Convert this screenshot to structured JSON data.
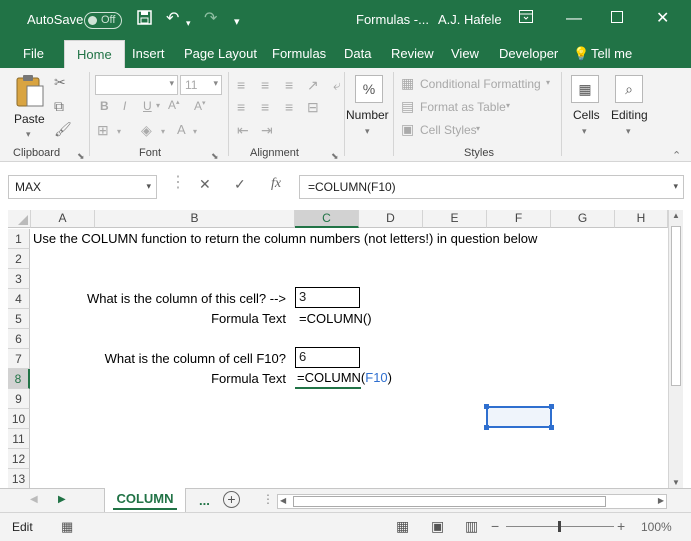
{
  "titlebar": {
    "autosave_label": "AutoSave",
    "autosave_state": "Off",
    "file_title": "Formulas -...",
    "user_name": "A.J. Hafele",
    "save_icon": "save-icon",
    "undo_icon": "undo-icon",
    "redo_icon": "redo-icon"
  },
  "tabs": [
    "File",
    "Home",
    "Insert",
    "Page Layout",
    "Formulas",
    "Data",
    "Review",
    "View",
    "Developer"
  ],
  "tell_me": "Tell me",
  "ribbon": {
    "paste": "Paste",
    "clipboard": "Clipboard",
    "font_group": "Font",
    "font_size": "11",
    "bold": "B",
    "italic": "I",
    "underline": "U",
    "alignment": "Alignment",
    "number": "Number",
    "number_symbol": "%",
    "conditional_formatting": "Conditional Formatting",
    "format_as_table": "Format as Table",
    "cell_styles": "Cell Styles",
    "styles": "Styles",
    "cells": "Cells",
    "editing": "Editing"
  },
  "formula_bar": {
    "name_box": "MAX",
    "fx": "fx",
    "formula": "=COLUMN(F10)"
  },
  "columns": [
    "A",
    "B",
    "C",
    "D",
    "E",
    "F",
    "G",
    "H"
  ],
  "rows": [
    "1",
    "2",
    "3",
    "4",
    "5",
    "6",
    "7",
    "8",
    "9",
    "10",
    "11",
    "12",
    "13"
  ],
  "cells": {
    "a1": "Use the COLUMN function to return the column numbers (not letters!) in question below",
    "b4": "What is the column of this cell? -->",
    "c4": "3",
    "b5": "Formula Text",
    "c5": "=COLUMN()",
    "b7": "What is the column of cell F10?",
    "c7": "6",
    "b8": "Formula Text",
    "c8_prefix": "=COLUMN(",
    "c8_ref": "F10",
    "c8_suffix": ")"
  },
  "sheet_tab": "COLUMN",
  "more_tabs": "...",
  "status": {
    "mode": "Edit",
    "zoom": "100%"
  },
  "colors": {
    "excel_green": "#217346",
    "ref_blue": "#2f6fcf"
  }
}
